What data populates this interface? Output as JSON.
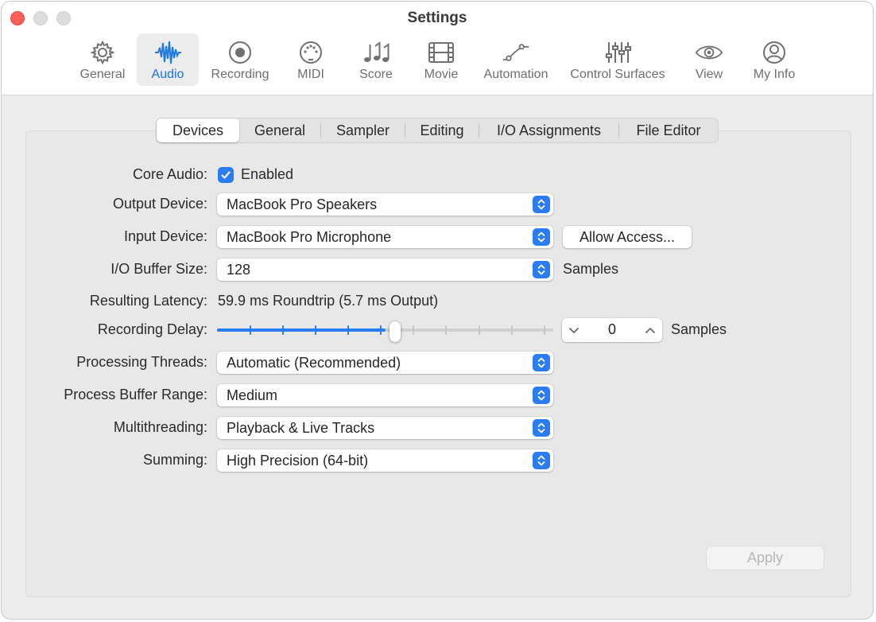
{
  "window": {
    "title": "Settings"
  },
  "toolbar": {
    "items": [
      {
        "label": "General",
        "icon": "gear-icon"
      },
      {
        "label": "Audio",
        "icon": "waveform-icon",
        "active": true
      },
      {
        "label": "Recording",
        "icon": "record-icon"
      },
      {
        "label": "MIDI",
        "icon": "midi-port-icon"
      },
      {
        "label": "Score",
        "icon": "music-notes-icon"
      },
      {
        "label": "Movie",
        "icon": "film-icon"
      },
      {
        "label": "Automation",
        "icon": "automation-curve-icon"
      },
      {
        "label": "Control Surfaces",
        "icon": "faders-icon"
      },
      {
        "label": "View",
        "icon": "eye-icon"
      },
      {
        "label": "My Info",
        "icon": "person-icon"
      }
    ]
  },
  "tabs": [
    "Devices",
    "General",
    "Sampler",
    "Editing",
    "I/O Assignments",
    "File Editor"
  ],
  "form": {
    "core_audio": {
      "label": "Core Audio:",
      "checkbox_label": "Enabled",
      "checked": true
    },
    "output_device": {
      "label": "Output Device:",
      "value": "MacBook Pro Speakers"
    },
    "input_device": {
      "label": "Input Device:",
      "value": "MacBook Pro Microphone",
      "button": "Allow Access..."
    },
    "buffer_size": {
      "label": "I/O Buffer Size:",
      "value": "128",
      "unit": "Samples"
    },
    "latency": {
      "label": "Resulting Latency:",
      "value": "59.9 ms Roundtrip (5.7 ms Output)"
    },
    "recording_delay": {
      "label": "Recording Delay:",
      "slider_fraction": 0.5,
      "value": "0",
      "unit": "Samples"
    },
    "processing_threads": {
      "label": "Processing Threads:",
      "value": "Automatic (Recommended)"
    },
    "process_buffer_range": {
      "label": "Process Buffer Range:",
      "value": "Medium"
    },
    "multithreading": {
      "label": "Multithreading:",
      "value": "Playback & Live Tracks"
    },
    "summing": {
      "label": "Summing:",
      "value": "High Precision (64-bit)"
    }
  },
  "apply_button": {
    "label": "Apply",
    "enabled": false
  },
  "colors": {
    "accent": "#2a7cf3",
    "close": "#ff5f57"
  }
}
